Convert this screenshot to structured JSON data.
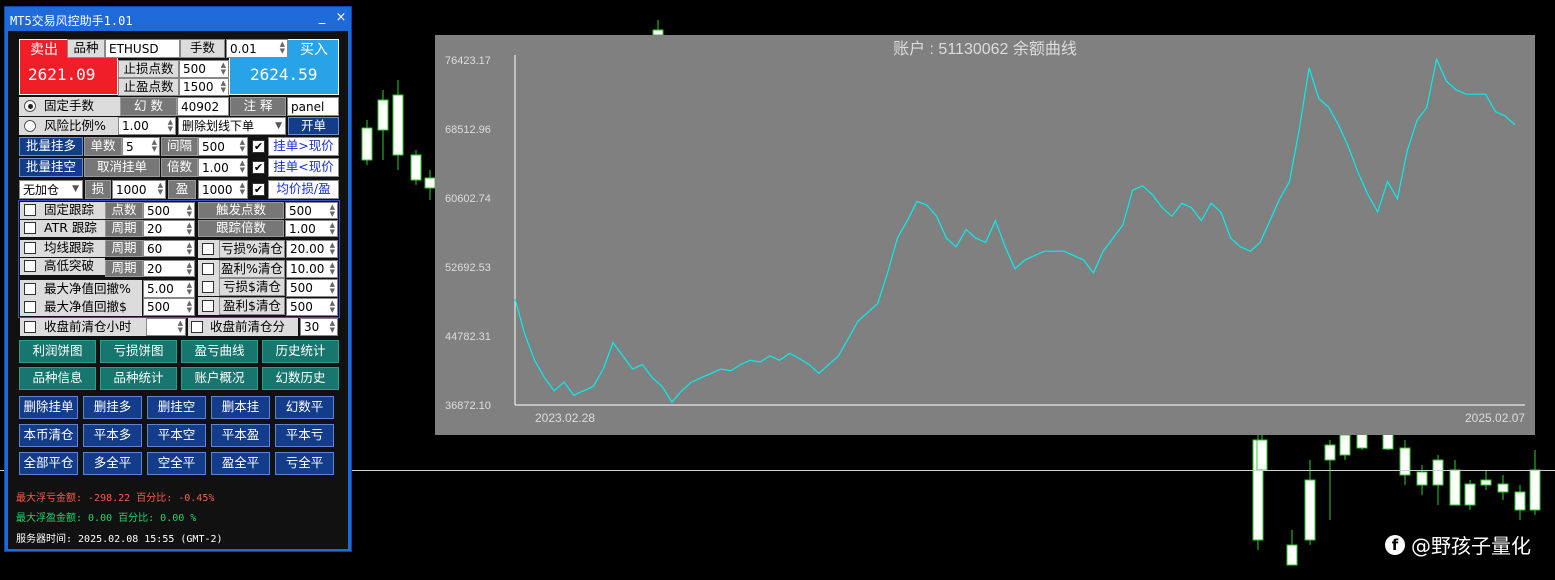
{
  "window": {
    "title": "MT5交易风控助手1.01",
    "min": "_",
    "close": "×"
  },
  "trade": {
    "sell_label": "卖出",
    "buy_label": "买入",
    "symbol_label": "品种",
    "symbol": "ETHUSD",
    "lots_label": "手数",
    "lots": "0.01",
    "bid": "2621.09",
    "ask": "2624.59",
    "sl_label": "止损点数",
    "sl": "500",
    "tp_label": "止盈点数",
    "tp": "1500"
  },
  "mode": {
    "fixed_lots": "固定手数",
    "magic_label": "幻 数",
    "magic": "40902",
    "comment_label": "注 释",
    "comment": "panel",
    "risk_pct": "风险比例%",
    "risk": "1.00",
    "delete_line": "删除划线下单",
    "open": "开单"
  },
  "batch": {
    "long": "批量挂多",
    "short": "批量挂空",
    "count_label": "单数",
    "count": "5",
    "gap_label": "间隔",
    "gap": "500",
    "cancel": "取消挂单",
    "mult_label": "倍数",
    "mult": "1.00",
    "above": "挂单>现价",
    "below": "挂单<现价",
    "noadd": "无加仓",
    "loss_label": "损",
    "loss": "1000",
    "profit_label": "盈",
    "profit": "1000",
    "avg": "均价损/盈"
  },
  "trail": {
    "fixed": "固定跟踪",
    "points_label": "点数",
    "points": "500",
    "trigger_label": "触发点数",
    "trigger": "500",
    "atr": "ATR 跟踪",
    "period_label": "周期",
    "atr_period": "20",
    "mult_label": "跟踪倍数",
    "atr_mult": "1.00",
    "ma": "均线跟踪",
    "ma_period": "60",
    "hilo": "高低突破",
    "hilo_period": "20",
    "loss_pct": "亏损%清仓",
    "loss_pct_v": "20.00",
    "profit_pct": "盈利%清仓",
    "profit_pct_v": "10.00",
    "loss_usd": "亏损$清仓",
    "loss_usd_v": "500",
    "profit_usd": "盈利$清仓",
    "profit_usd_v": "500",
    "max_dd_pct": "最大净值回撤%",
    "max_dd_pct_v": "5.00",
    "max_dd_usd": "最大净值回撤$",
    "max_dd_usd_v": "500",
    "close_hour": "收盘前清仓小时",
    "close_min": "收盘前清仓分",
    "close_min_v": "30"
  },
  "buttons1": [
    "利润饼图",
    "亏损饼图",
    "盈亏曲线",
    "历史统计",
    "品种信息",
    "品种统计",
    "账户概况",
    "幻数历史"
  ],
  "buttons2": [
    "删除挂单",
    "删挂多",
    "删挂空",
    "删本挂",
    "幻数平",
    "本币清仓",
    "平本多",
    "平本空",
    "平本盈",
    "平本亏",
    "全部平仓",
    "多全平",
    "空全平",
    "盈全平",
    "亏全平"
  ],
  "info": {
    "float_loss": "最大浮亏金额: -298.22 百分比: -0.45%",
    "float_profit": "最大浮盈金额: 0.00  百分比:  0.00 %",
    "server_time": "服务器时间: 2025.02.08 15:55 (GMT-2)",
    "loss_color": "#ff5a4a",
    "profit_color": "#22d46a"
  },
  "chart_data": {
    "type": "line",
    "title": "账户 : 51130062 余额曲线",
    "x_start": "2023.02.28",
    "x_end": "2025.02.07",
    "yticks": [
      "76423.17",
      "68512.96",
      "60602.74",
      "52692.53",
      "44782.31",
      "36872.10"
    ],
    "ylim": [
      36872.1,
      76423.17
    ],
    "line_color": "#00f0f0",
    "background": "#808080",
    "series": [
      {
        "values": [
          49000,
          45000,
          42000,
          40000,
          38500,
          39500,
          38000,
          38500,
          39000,
          41000,
          44000,
          42500,
          41000,
          41500,
          40000,
          39000,
          37200,
          38500,
          39500,
          40000,
          40500,
          41000,
          40800,
          41500,
          42000,
          41800,
          42500,
          42000,
          42800,
          42200,
          41500,
          40500,
          41500,
          42500,
          44500,
          46500,
          47500,
          48500,
          52000,
          56000,
          58000,
          60200,
          59800,
          58500,
          56000,
          55000,
          57000,
          56000,
          55500,
          58000,
          55000,
          52500,
          53500,
          54000,
          54500,
          54500,
          54500,
          54000,
          53500,
          52000,
          54500,
          56000,
          57500,
          61500,
          62000,
          61000,
          59500,
          58500,
          60000,
          59500,
          58000,
          60000,
          59000,
          56000,
          55000,
          54500,
          55500,
          58000,
          60500,
          62500,
          68500,
          75500,
          72000,
          71000,
          69000,
          66500,
          63500,
          61000,
          59000,
          62500,
          60500,
          66000,
          69500,
          71000,
          76500,
          74000,
          73000,
          72500,
          72500,
          72500,
          70500,
          70000,
          69000
        ]
      }
    ]
  },
  "watermark": {
    "icon": "f",
    "text": "@野孩子量化"
  }
}
